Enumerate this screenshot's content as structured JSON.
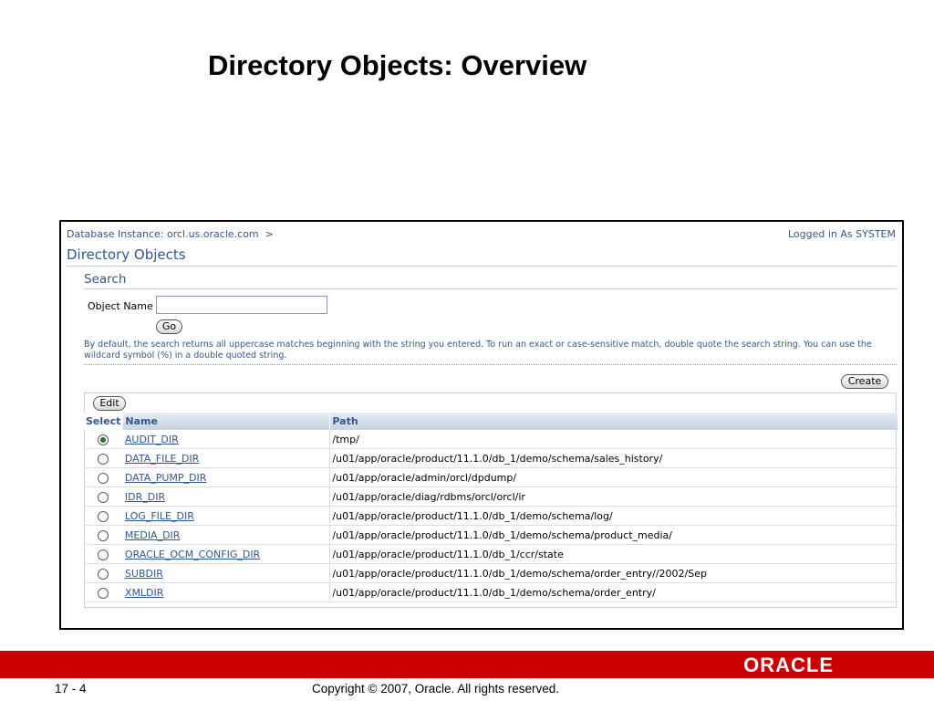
{
  "slide": {
    "title": "Directory Objects: Overview",
    "page_number": "17 - 4",
    "copyright": "Copyright © 2007, Oracle. All rights reserved.",
    "logo_text": "ORACLE"
  },
  "app": {
    "breadcrumb": "Database Instance: orcl.us.oracle.com",
    "breadcrumb_separator": ">",
    "logged_in": "Logged in As SYSTEM",
    "page_title": "Directory Objects",
    "search": {
      "heading": "Search",
      "object_name_label": "Object Name",
      "object_name_value": "",
      "go_label": "Go",
      "hint": "By default, the search returns all uppercase matches beginning with the string you entered. To run an exact or case-sensitive match, double quote the search string. You can use the wildcard symbol (%) in a double quoted string."
    },
    "create_label": "Create",
    "edit_label": "Edit",
    "table": {
      "columns": [
        "Select",
        "Name",
        "Path"
      ],
      "rows": [
        {
          "name": "AUDIT_DIR",
          "path": "/tmp/",
          "selected": true
        },
        {
          "name": "DATA_FILE_DIR",
          "path": "/u01/app/oracle/product/11.1.0/db_1/demo/schema/sales_history/",
          "selected": false
        },
        {
          "name": "DATA_PUMP_DIR",
          "path": "/u01/app/oracle/admin/orcl/dpdump/",
          "selected": false
        },
        {
          "name": "IDR_DIR",
          "path": "/u01/app/oracle/diag/rdbms/orcl/orcl/ir",
          "selected": false
        },
        {
          "name": "LOG_FILE_DIR",
          "path": "/u01/app/oracle/product/11.1.0/db_1/demo/schema/log/",
          "selected": false
        },
        {
          "name": "MEDIA_DIR",
          "path": "/u01/app/oracle/product/11.1.0/db_1/demo/schema/product_media/",
          "selected": false
        },
        {
          "name": "ORACLE_OCM_CONFIG_DIR",
          "path": "/u01/app/oracle/product/11.1.0/db_1/ccr/state",
          "selected": false
        },
        {
          "name": "SUBDIR",
          "path": "/u01/app/oracle/product/11.1.0/db_1/demo/schema/order_entry//2002/Sep",
          "selected": false
        },
        {
          "name": "XMLDIR",
          "path": "/u01/app/oracle/product/11.1.0/db_1/demo/schema/order_entry/",
          "selected": false
        }
      ]
    }
  },
  "colors": {
    "link_blue": "#335792",
    "oracle_red": "#cc0000"
  }
}
